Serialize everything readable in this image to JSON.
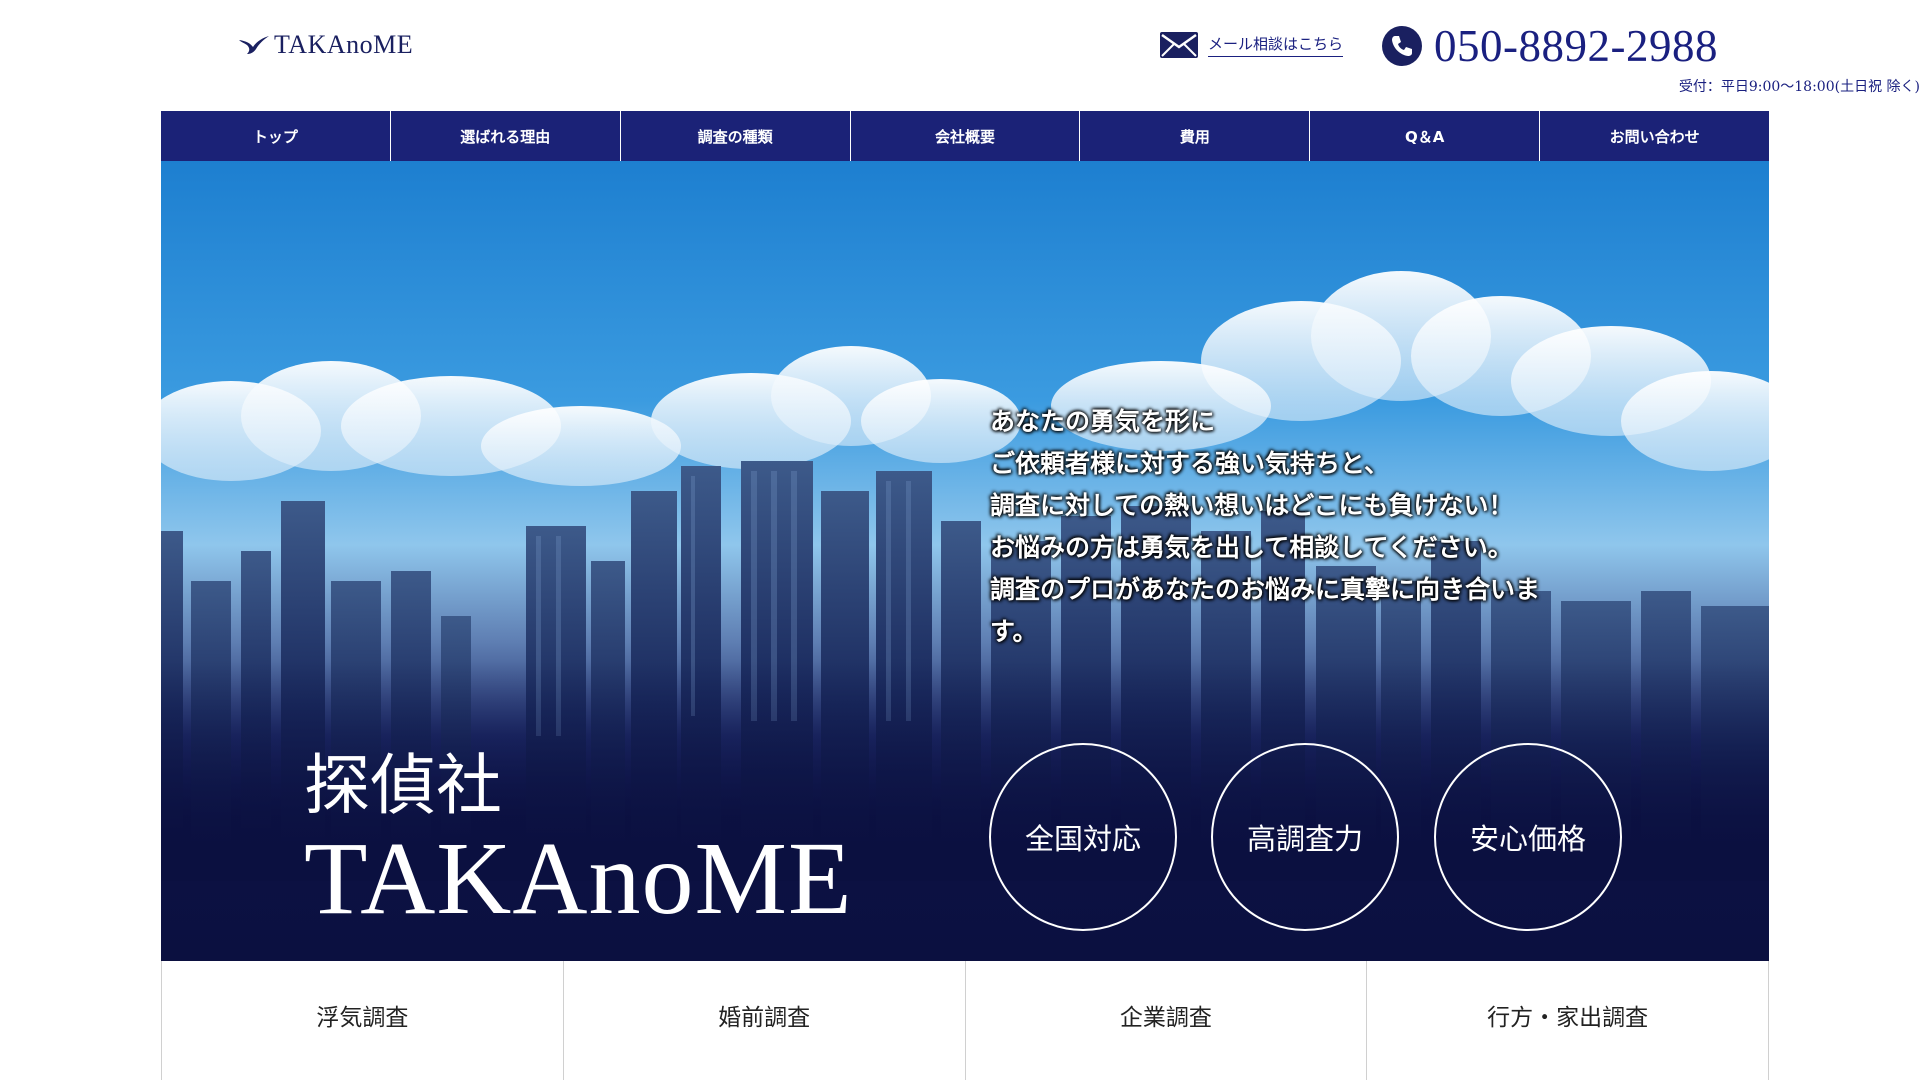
{
  "header": {
    "logo_text": "TAKAnoME",
    "mail_label": "メール相談はこちら",
    "phone": "050-8892-2988",
    "hours": "受付：平日9:00〜18:00(土日祝 除く)"
  },
  "nav": [
    {
      "label": "トップ"
    },
    {
      "label": "選ばれる理由"
    },
    {
      "label": "調査の種類"
    },
    {
      "label": "会社概要"
    },
    {
      "label": "費用"
    },
    {
      "label": "Q＆A"
    },
    {
      "label": "お問い合わせ"
    }
  ],
  "hero": {
    "tagline": [
      "あなたの勇気を形に",
      "ご依頼者様に対する強い気持ちと、",
      "調査に対しての熱い想いはどこにも負けない！",
      "お悩みの方は勇気を出して相談してください。",
      "調査のプロがあなたのお悩みに真摯に向き合いま",
      "す。"
    ],
    "brand_sub": "探偵社",
    "brand_main": "TAKAnoME",
    "badges": [
      "全国対応",
      "高調査力",
      "安心価格"
    ]
  },
  "services": [
    "浮気調査",
    "婚前調査",
    "企業調査",
    "行方・家出調査"
  ],
  "colors": {
    "brand_navy": "#1b2277",
    "hero_dark": "#0b1040",
    "sky_blue": "#2a8ad6"
  },
  "icons": {
    "logo": "hawk-icon",
    "mail": "envelope-icon",
    "phone": "phone-icon"
  }
}
